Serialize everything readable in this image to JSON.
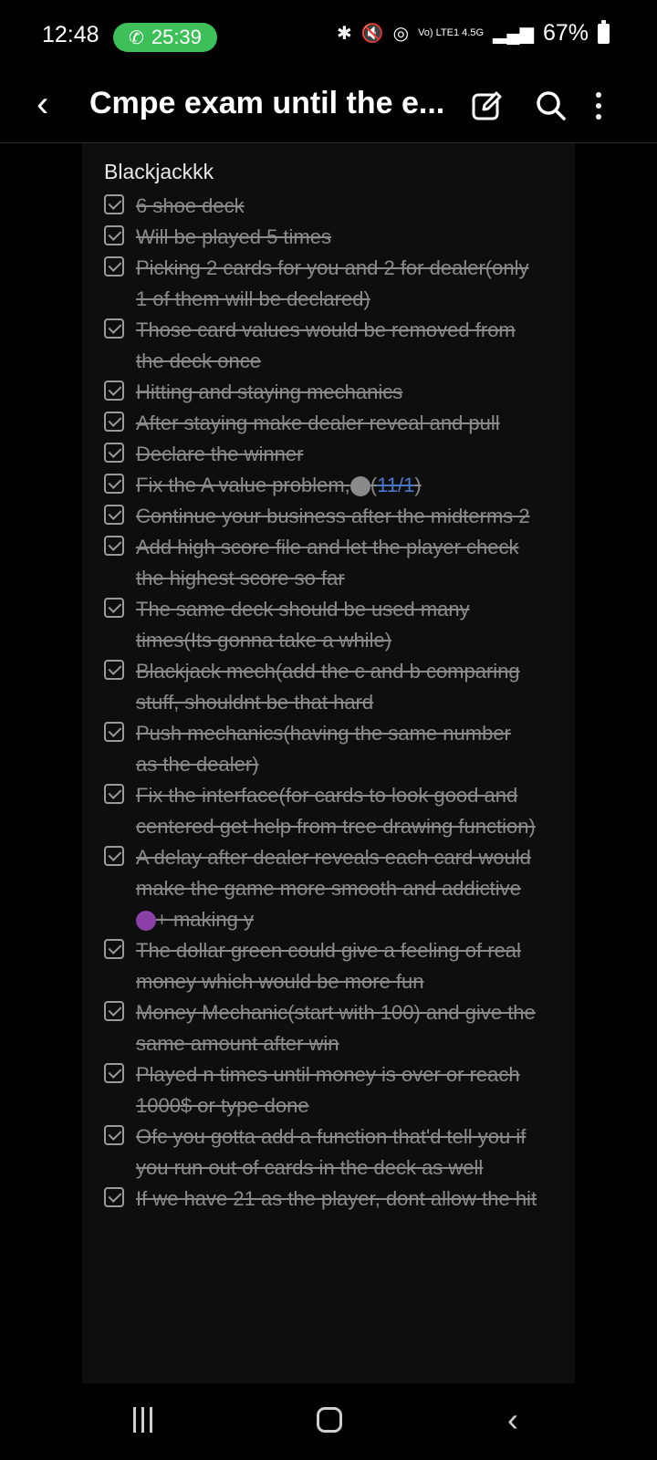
{
  "status_bar": {
    "time": "12:48",
    "call_timer": "25:39",
    "network": "Vo) LTE1 4.5G",
    "battery_percent": "67%",
    "icons": [
      "bluetooth-icon",
      "mute-icon",
      "hotspot-icon",
      "signal-icon",
      "battery-icon"
    ]
  },
  "app_bar": {
    "title": "Cmpe exam until the e...",
    "icons": [
      "back-icon",
      "edit-icon",
      "search-icon",
      "more-icon"
    ]
  },
  "note": {
    "title": "Blackjackkk",
    "items": [
      {
        "text": "6 shoe deck",
        "checked": true
      },
      {
        "text": "Will be played 5 times",
        "checked": true
      },
      {
        "text": "Picking 2 cards for you and 2 for dealer(only 1 of them will be declared)",
        "checked": true
      },
      {
        "text": "Those card values would be removed from the deck once",
        "checked": true
      },
      {
        "text": "Hitting and staying mechanics",
        "checked": true
      },
      {
        "text": "After staying make dealer reveal and pull",
        "checked": true
      },
      {
        "text": "Declare the winner",
        "checked": true
      },
      {
        "text_before": "Fix the A value problem,",
        "emoji": "skull",
        "text_after": "(",
        "link": "11/1",
        "text_end": ")",
        "checked": true
      },
      {
        "text": "Continue your business after the midterms 2",
        "checked": true
      },
      {
        "text": "Add high score file and let the player check the highest score so far",
        "checked": true
      },
      {
        "text": "The same deck should be used many times(Its gonna take a while)",
        "checked": true
      },
      {
        "text": "Blackjack mech(add the c and b comparing stuff, shouldnt be that hard",
        "checked": true
      },
      {
        "text": "Push mechanics(having the same number as the dealer)",
        "checked": true
      },
      {
        "text": "Fix the interface(for cards to look good and centered get help from tree drawing function)",
        "checked": true
      },
      {
        "text_before": "A delay after dealer reveals each card would make the game more smooth and addictive ",
        "emoji": "devil",
        "text_after": "+ making y",
        "checked": true
      },
      {
        "text": "The dollar green could give a feeling of real money which would be more fun",
        "checked": true
      },
      {
        "text": "Money Mechanic(start with 100) and give the same amount after win",
        "checked": true
      },
      {
        "text": "Played n times until money is over or reach 1000$ or type done",
        "checked": true
      },
      {
        "text": "Ofc you gotta add a function that'd tell you if you run out of cards in the deck as well",
        "checked": true
      },
      {
        "text": "If we have 21 as the player, dont allow the hit",
        "checked": true
      }
    ]
  },
  "nav_bar": {
    "icons": [
      "recents-icon",
      "home-icon",
      "back-icon"
    ]
  }
}
